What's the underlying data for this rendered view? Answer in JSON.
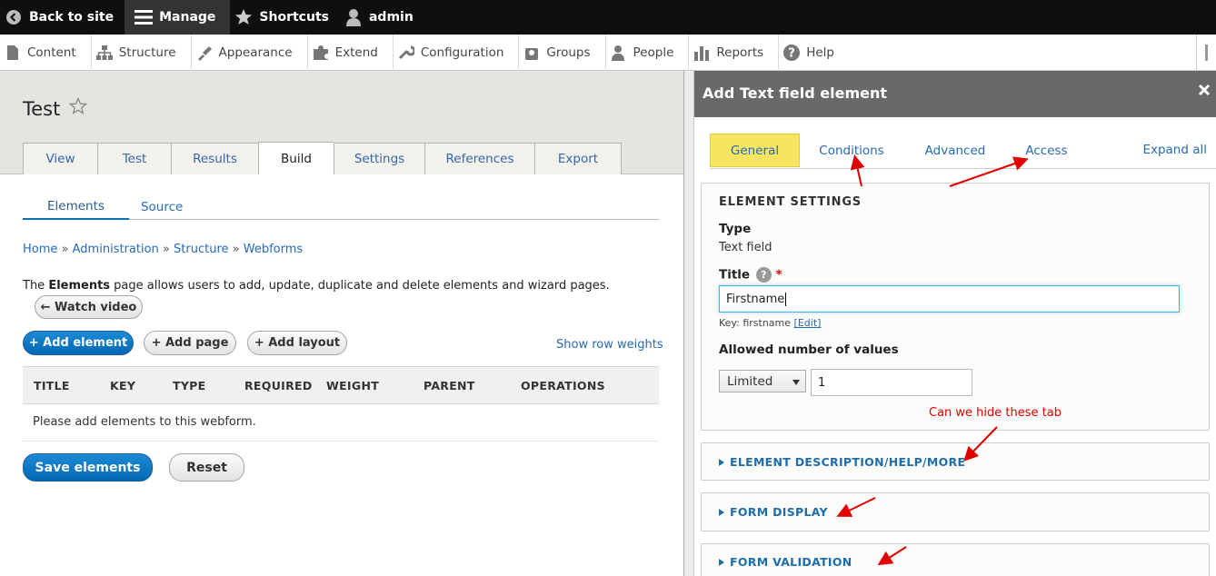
{
  "toolbar": {
    "back_to_site": "Back to site",
    "manage": "Manage",
    "shortcuts": "Shortcuts",
    "user": "admin"
  },
  "tray": {
    "items": [
      "Content",
      "Structure",
      "Appearance",
      "Extend",
      "Configuration",
      "Groups",
      "People",
      "Reports",
      "Help"
    ]
  },
  "page": {
    "title": "Test",
    "tabs": [
      "View",
      "Test",
      "Results",
      "Build",
      "Settings",
      "References",
      "Export"
    ],
    "active_tab": "Build",
    "subtabs": [
      "Elements",
      "Source"
    ],
    "breadcrumb": [
      "Home",
      "Administration",
      "Structure",
      "Webforms"
    ],
    "breadcrumb_sep": "»",
    "help_pre": "The ",
    "help_bold": "Elements",
    "help_post": " page allows users to add, update, duplicate and delete elements and wizard pages.",
    "watch_video": "← Watch video",
    "add_element": "+ Add element",
    "add_page": "+ Add page",
    "add_layout": "+ Add layout",
    "show_row_weights": "Show row weights",
    "table_headers": [
      "TITLE",
      "KEY",
      "TYPE",
      "REQUIRED",
      "WEIGHT",
      "PARENT",
      "OPERATIONS"
    ],
    "empty_message": "Please add elements to this webform.",
    "save_elements": "Save elements",
    "reset": "Reset"
  },
  "dialog": {
    "title": "Add Text field element",
    "tabs": [
      "General",
      "Conditions",
      "Advanced",
      "Access"
    ],
    "active_tab": "General",
    "expand_all": "Expand all",
    "element_settings": {
      "legend": "ELEMENT SETTINGS",
      "type_label": "Type",
      "type_value": "Text field",
      "title_label": "Title",
      "required_mark": "*",
      "help_icon": "?",
      "title_value": "Firstname",
      "key_prefix": "Key: firstname ",
      "key_edit": "[Edit]",
      "allowed_label": "Allowed number of values",
      "allowed_select": "Limited",
      "allowed_number": "1"
    },
    "sections": [
      "ELEMENT DESCRIPTION/HELP/MORE",
      "FORM DISPLAY",
      "FORM VALIDATION"
    ]
  },
  "annotation": "Can we hide these tab",
  "colors": {
    "toolbar_bg": "#0f0f0f",
    "primary_button": "#0074bd",
    "active_tab_highlight": "#f7e460",
    "annotation": "#e00000",
    "link": "#2769b5"
  }
}
